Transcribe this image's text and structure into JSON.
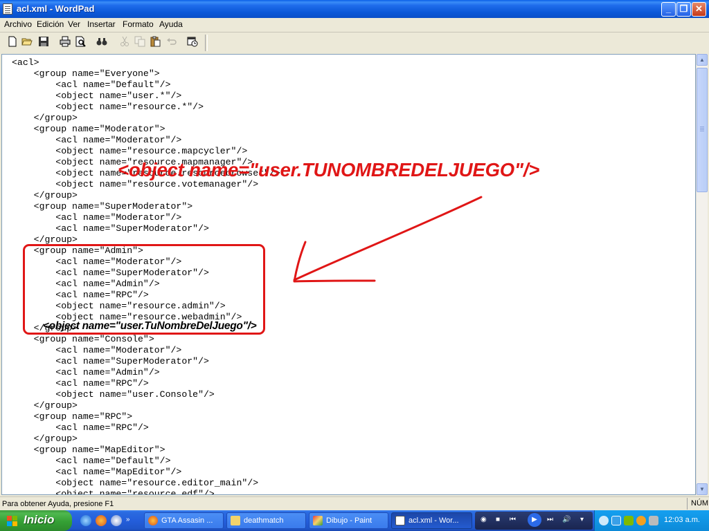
{
  "window": {
    "title": "acl.xml - WordPad",
    "min": "_",
    "max": "❐",
    "close": "✕"
  },
  "menu": [
    "Archivo",
    "Edición",
    "Ver",
    "Insertar",
    "Formato",
    "Ayuda"
  ],
  "editor": {
    "lines": [
      "<acl>",
      "    <group name=\"Everyone\">",
      "        <acl name=\"Default\"/>",
      "        <object name=\"user.*\"/>",
      "        <object name=\"resource.*\"/>",
      "    </group>",
      "    <group name=\"Moderator\">",
      "        <acl name=\"Moderator\"/>",
      "        <object name=\"resource.mapcycler\"/>",
      "        <object name=\"resource.mapmanager\"/>",
      "        <object name=\"resource.resourcebrowser\"/>",
      "        <object name=\"resource.votemanager\"/>",
      "    </group>",
      "    <group name=\"SuperModerator\">",
      "        <acl name=\"Moderator\"/>",
      "        <acl name=\"SuperModerator\"/>",
      "    </group>",
      "    <group name=\"Admin\">",
      "        <acl name=\"Moderator\"/>",
      "        <acl name=\"SuperModerator\"/>",
      "        <acl name=\"Admin\"/>",
      "        <acl name=\"RPC\"/>",
      "        <object name=\"resource.admin\"/>",
      "        <object name=\"resource.webadmin\"/>",
      "    </group>",
      "    <group name=\"Console\">",
      "        <acl name=\"Moderator\"/>",
      "        <acl name=\"SuperModerator\"/>",
      "        <acl name=\"Admin\"/>",
      "        <acl name=\"RPC\"/>",
      "        <object name=\"user.Console\"/>",
      "    </group>",
      "    <group name=\"RPC\">",
      "        <acl name=\"RPC\"/>",
      "    </group>",
      "    <group name=\"MapEditor\">",
      "        <acl name=\"Default\"/>",
      "        <acl name=\"MapEditor\"/>",
      "        <object name=\"resource.editor_main\"/>",
      "        <object name=\"resource.edf\"/>"
    ]
  },
  "annotations": {
    "big_text": "<object name=\"user.TUNOMBREDELJUEGO\"/>",
    "small_text": "<object name=\"user.TuNombreDelJuego\"/>",
    "color": "#E01616"
  },
  "status": {
    "help": "Para obtener Ayuda, presione F1",
    "num": "NÚM"
  },
  "taskbar": {
    "start": "Inicio",
    "tasks": [
      {
        "label": "GTA Assasin ...",
        "icon": "firefox-icon"
      },
      {
        "label": "deathmatch",
        "icon": "folder-icon"
      },
      {
        "label": "Dibujo - Paint",
        "icon": "paint-icon"
      },
      {
        "label": "acl.xml - Wor...",
        "icon": "wordpad-icon"
      }
    ],
    "clock": "12:03 a.m."
  }
}
